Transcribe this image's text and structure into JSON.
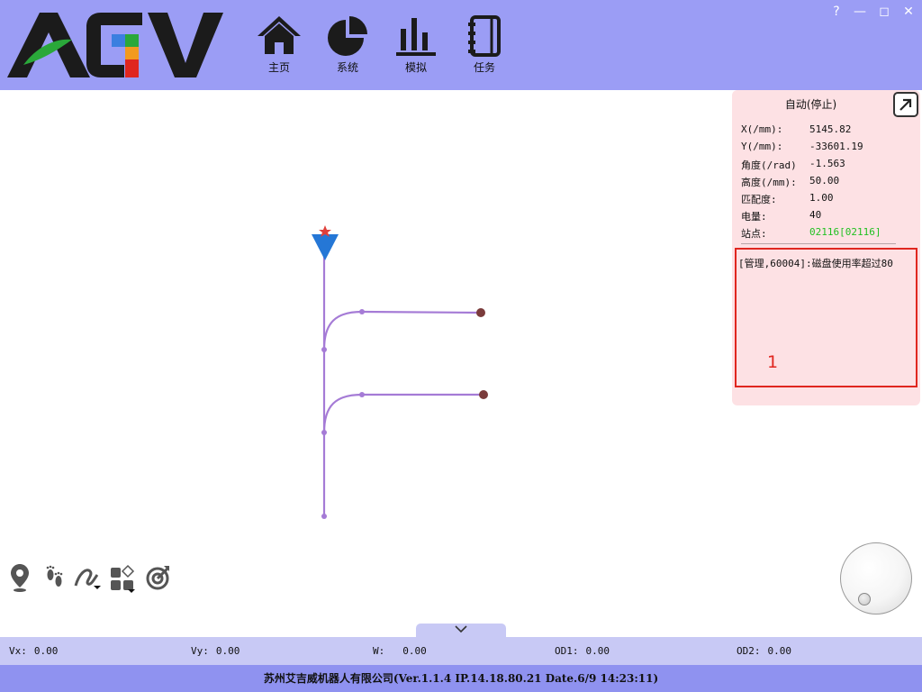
{
  "window": {
    "help": "?",
    "minimize": "—",
    "maximize": "◻",
    "close": "✕"
  },
  "header": {
    "logo_text": "AGV",
    "nav": [
      {
        "label": "主页",
        "icon": "home-icon"
      },
      {
        "label": "系统",
        "icon": "pie-chart-icon"
      },
      {
        "label": "模拟",
        "icon": "bar-chart-icon"
      },
      {
        "label": "任务",
        "icon": "notebook-icon"
      }
    ]
  },
  "panel": {
    "title": "自动(停止)",
    "rows": [
      {
        "label": "X(/mm):",
        "value": "5145.82"
      },
      {
        "label": "Y(/mm):",
        "value": "-33601.19"
      },
      {
        "label": "角度(/rad)",
        "value": "-1.563"
      },
      {
        "label": "高度(/mm):",
        "value": "50.00"
      },
      {
        "label": "匹配度:",
        "value": "1.00"
      },
      {
        "label": "电量:",
        "value": "40"
      },
      {
        "label": "站点:",
        "value": "02116[02116]"
      }
    ],
    "message": "[管理,60004]:磁盘使用率超过80",
    "annotation": "1",
    "colors": {
      "station": "#22c022",
      "highlight_border": "#e0261f"
    }
  },
  "tools": [
    "location-pin-icon",
    "footprints-icon",
    "path-draw-icon",
    "widgets-icon",
    "target-icon"
  ],
  "velocity": [
    {
      "label": "Vx:",
      "value": "0.00"
    },
    {
      "label": "Vy:",
      "value": "0.00"
    },
    {
      "label": "W:",
      "value": "0.00"
    },
    {
      "label": "OD1:",
      "value": "0.00"
    },
    {
      "label": "OD2:",
      "value": "0.00"
    }
  ],
  "footer": {
    "text": "苏州艾吉威机器人有限公司(Ver.1.1.4 IP.14.18.80.21 Date.6/9 14:23:11)"
  },
  "map": {
    "path_color": "#a57bd6",
    "endpoint_color": "#7a3b3b",
    "agv_color": "#2577d6",
    "marker_color": "#e0403b"
  }
}
